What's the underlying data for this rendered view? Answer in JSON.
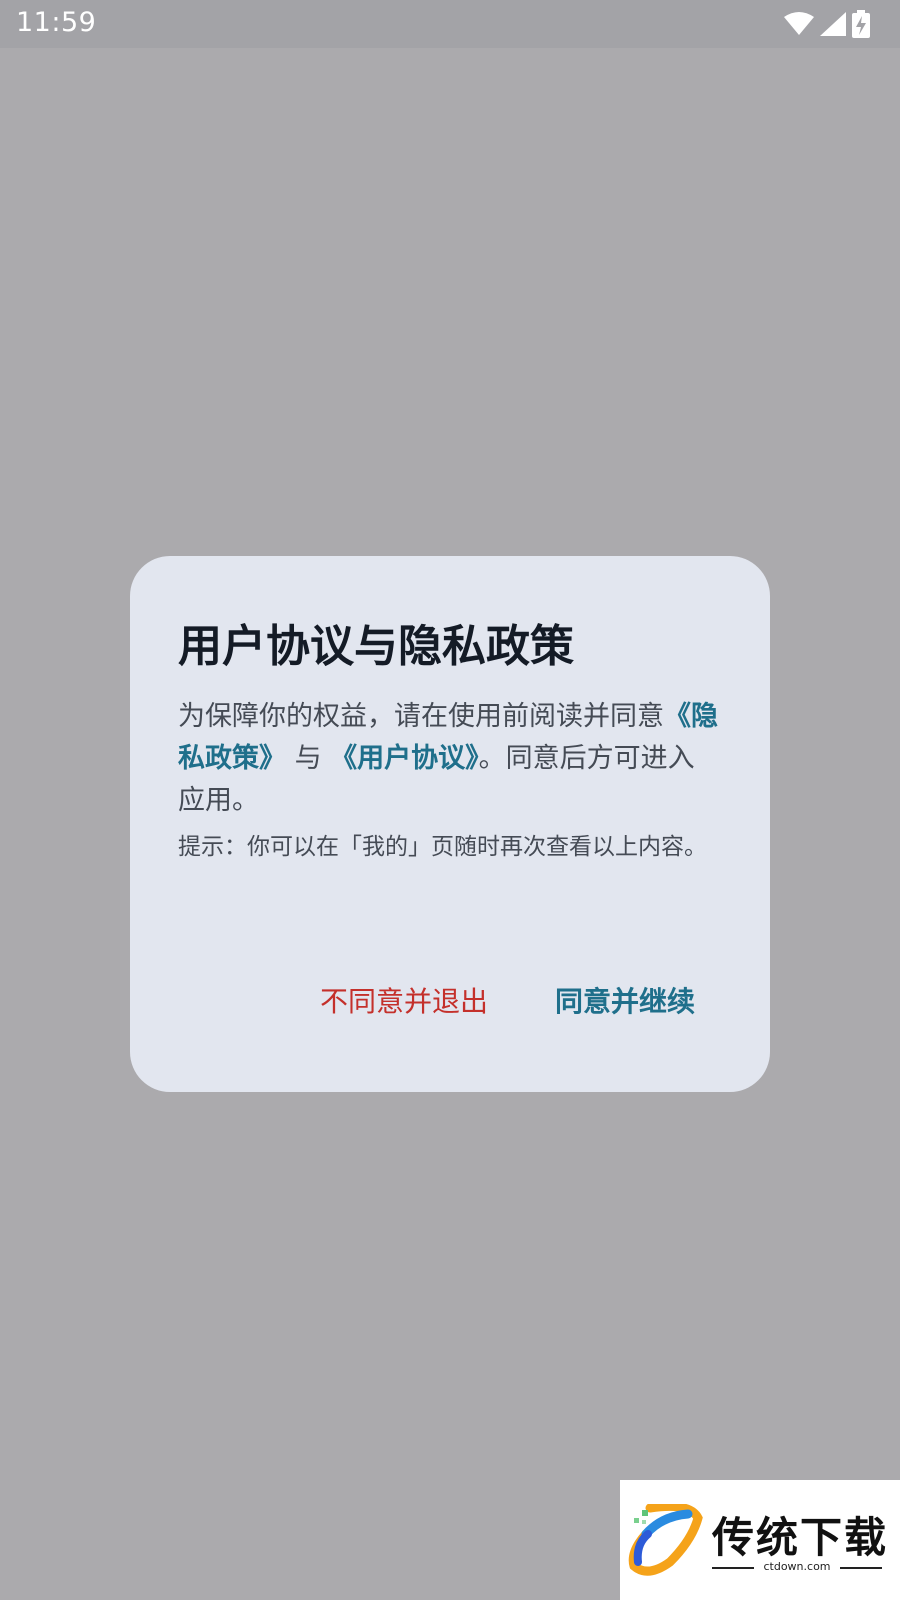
{
  "status_bar": {
    "time": "11:59",
    "icons": [
      "wifi-icon",
      "signal-icon",
      "battery-charging-icon"
    ]
  },
  "dialog": {
    "title": "用户协议与隐私政策",
    "body_prefix": "为保障你的权益，请在使用前阅读并同意",
    "privacy_link": "《隐私政策》",
    "connector": " 与 ",
    "terms_link": "《用户协议》",
    "body_suffix": "。同意后方可进入应用。",
    "hint": "提示：你可以在「我的」页随时再次查看以上内容。",
    "decline_label": "不同意并退出",
    "accept_label": "同意并继续"
  },
  "watermark": {
    "brand": "传统下载",
    "domain": "ctdown.com"
  },
  "colors": {
    "overlay": "#ABAAAD",
    "dialog_bg": "#E2E6EF",
    "title": "#141B26",
    "link": "#1F6F8B",
    "decline": "#C4302B",
    "accept": "#1F6F8B"
  }
}
